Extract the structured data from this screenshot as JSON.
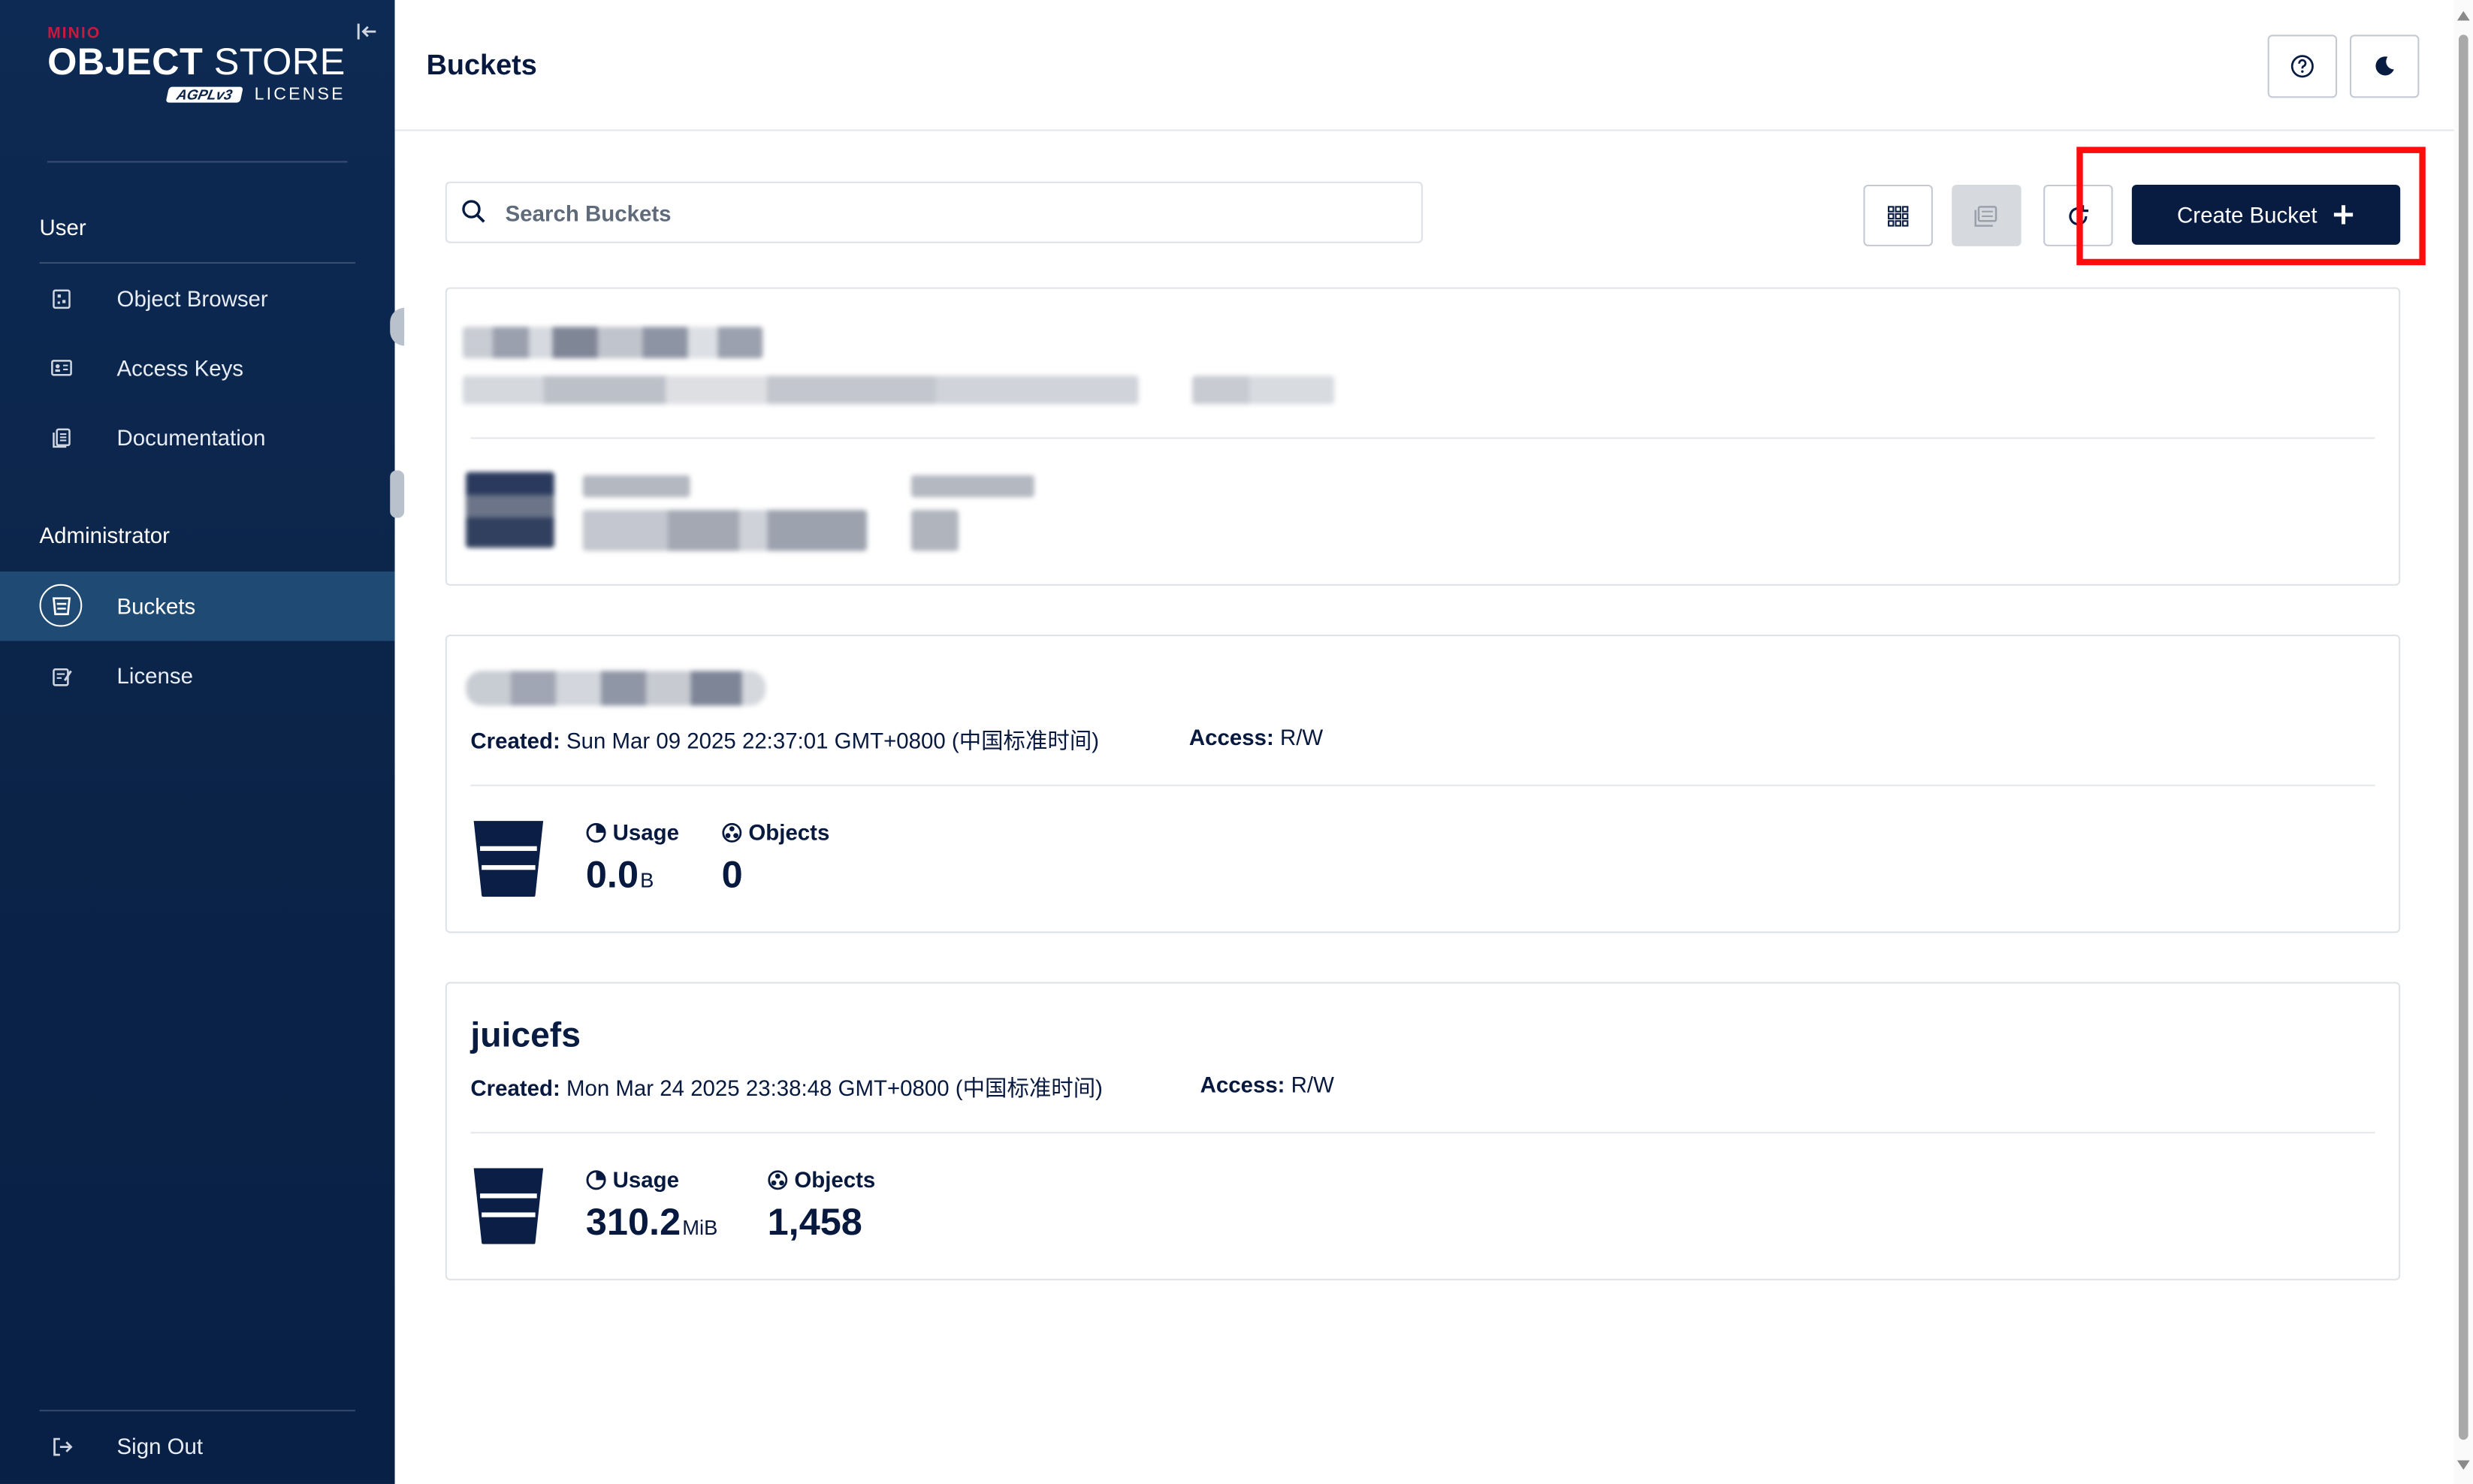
{
  "brand": {
    "minio": "MINIO",
    "product_bold": "OBJECT",
    "product_rest": " STORE",
    "agpl": "AGPLv3",
    "license_word": "LICENSE"
  },
  "sidebar": {
    "sections": [
      {
        "label": "User",
        "items": [
          {
            "label": "Object Browser",
            "icon": "object-browser-icon"
          },
          {
            "label": "Access Keys",
            "icon": "access-keys-icon"
          },
          {
            "label": "Documentation",
            "icon": "documentation-icon"
          }
        ]
      },
      {
        "label": "Administrator",
        "items": [
          {
            "label": "Buckets",
            "icon": "bucket-icon",
            "active": true
          },
          {
            "label": "License",
            "icon": "license-icon"
          }
        ]
      }
    ],
    "sign_out": "Sign Out"
  },
  "header": {
    "title": "Buckets",
    "help_icon": "help-icon",
    "theme_icon": "moon-icon"
  },
  "toolbar": {
    "search_placeholder": "Search Buckets",
    "create_label": "Create Bucket",
    "create_icon": "plus-icon"
  },
  "buckets": [
    {
      "name": "",
      "created_label": "",
      "created": "",
      "access_label": "",
      "access": "",
      "usage_label": "",
      "usage_value": "",
      "usage_unit": "",
      "objects_label": "",
      "objects": "",
      "redacted": true
    },
    {
      "name": "",
      "created_label": "Created:",
      "created": " Sun Mar 09 2025 22:37:01 GMT+0800 (中国标准时间)",
      "access_label": "Access:",
      "access": " R/W",
      "usage_label": "Usage",
      "usage_value": "0.0",
      "usage_unit": "B",
      "objects_label": "Objects",
      "objects": "0",
      "name_redacted": true
    },
    {
      "name": "juicefs",
      "created_label": "Created:",
      "created": " Mon Mar 24 2025 23:38:48 GMT+0800 (中国标准时间)",
      "access_label": "Access:",
      "access": " R/W",
      "usage_label": "Usage",
      "usage_value": "310.2",
      "usage_unit": "MiB",
      "objects_label": "Objects",
      "objects": "1,458"
    }
  ],
  "colors": {
    "sidebar_bg": "#0b2347",
    "active_item": "#1e4a74",
    "primary_button": "#081c42",
    "highlight_box": "#ff0d0d",
    "brand_red": "#c51b3f"
  }
}
